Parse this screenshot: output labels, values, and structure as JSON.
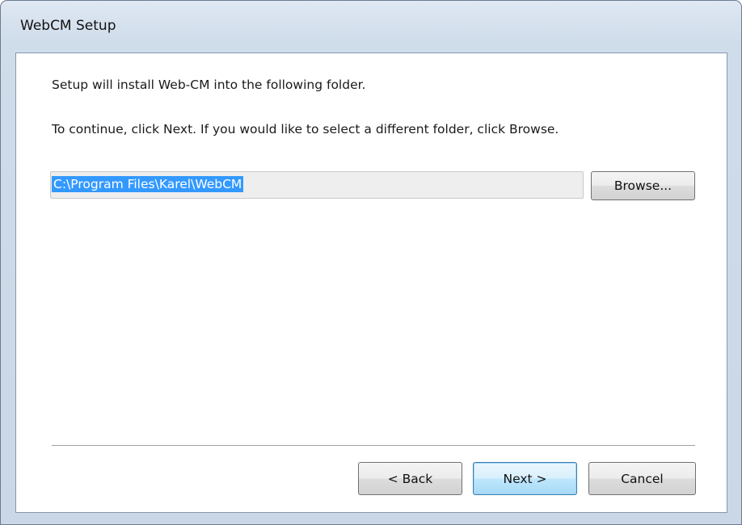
{
  "window": {
    "title": "WebCM Setup"
  },
  "body": {
    "intro_text": "Setup will install Web-CM into the following folder.",
    "instruction_text": "To continue, click Next. If you would like to select a different folder, click Browse."
  },
  "folder": {
    "path": "C:\\Program Files\\Karel\\WebCM",
    "browse_label": "Browse..."
  },
  "buttons": {
    "back_label": "< Back",
    "next_label": "Next >",
    "cancel_label": "Cancel"
  }
}
